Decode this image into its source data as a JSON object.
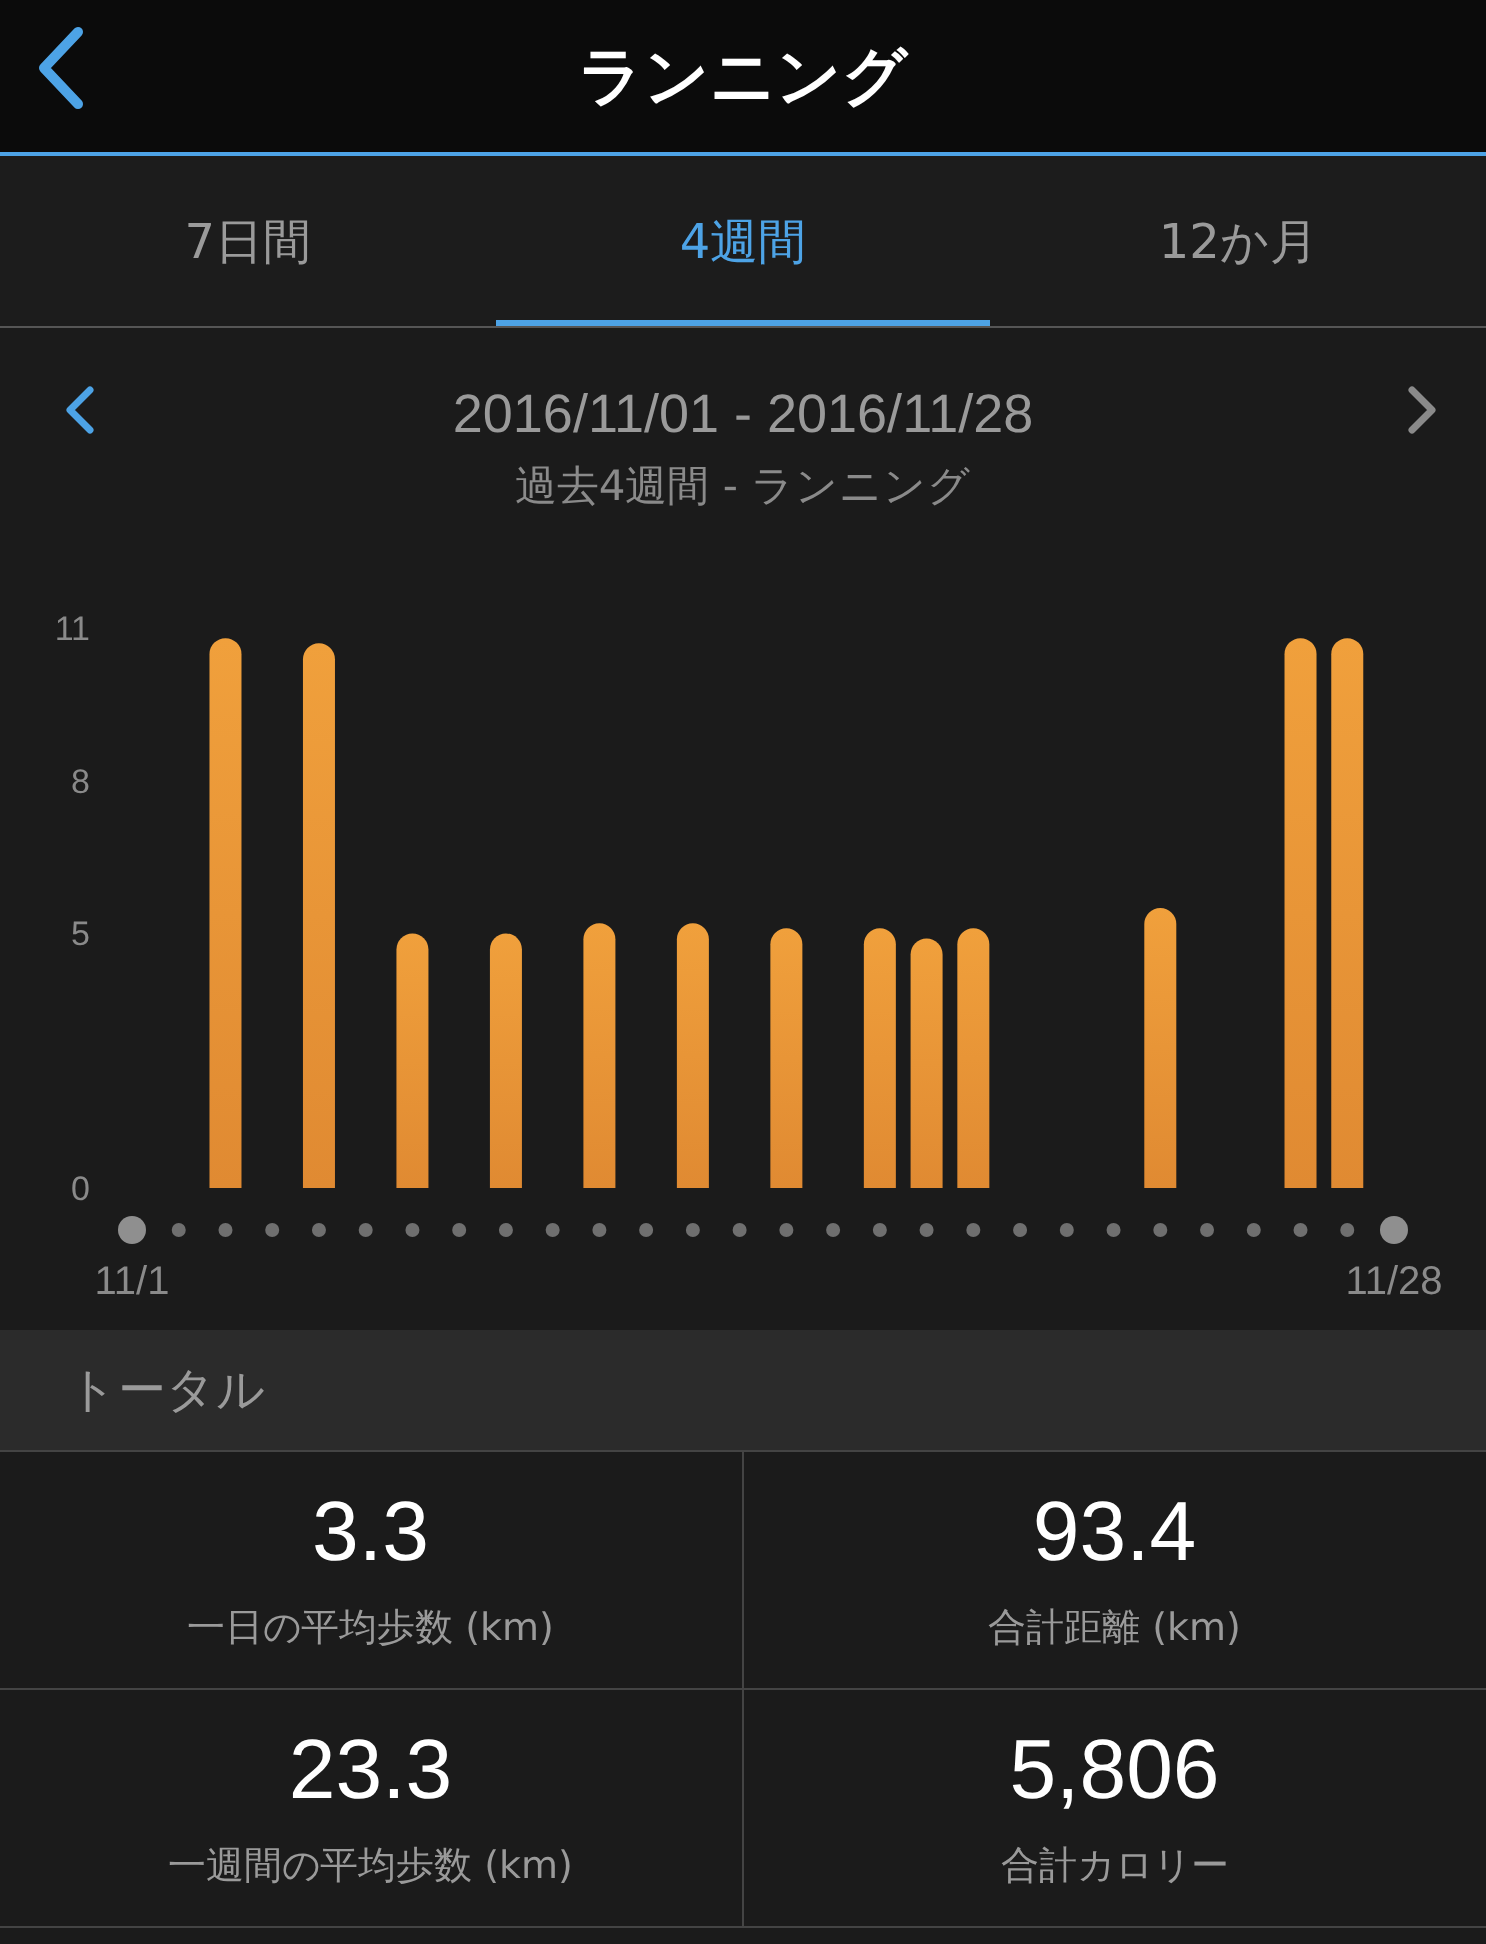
{
  "header": {
    "title": "ランニング"
  },
  "tabs": [
    {
      "label": "7日間",
      "selected": false
    },
    {
      "label": "4週間",
      "selected": true
    },
    {
      "label": "12か月",
      "selected": false
    }
  ],
  "period": {
    "range": "2016/11/01 - 2016/11/28",
    "subtitle": "過去4週間 - ランニング"
  },
  "chart_data": {
    "type": "bar",
    "categories": [
      "11/1",
      null,
      null,
      null,
      null,
      null,
      null,
      null,
      null,
      null,
      null,
      null,
      null,
      null,
      null,
      null,
      null,
      null,
      null,
      null,
      null,
      null,
      null,
      null,
      null,
      null,
      null,
      "11/28"
    ],
    "series": [
      {
        "color": "#f0a03c",
        "values": [
          null,
          null,
          10.8,
          null,
          10.7,
          null,
          5.0,
          null,
          5.0,
          null,
          5.2,
          null,
          5.2,
          null,
          5.1,
          null,
          5.1,
          4.9,
          5.1,
          null,
          null,
          null,
          5.5,
          null,
          null,
          10.8,
          10.8,
          null
        ]
      }
    ],
    "ylim": [
      0,
      11
    ],
    "yticks": [
      0,
      5,
      8,
      11
    ]
  },
  "totals": {
    "title": "トータル",
    "stats": [
      {
        "value": "3.3",
        "label": "一日の平均歩数 (km)"
      },
      {
        "value": "93.4",
        "label": "合計距離 (km)"
      },
      {
        "value": "23.3",
        "label": "一週間の平均歩数 (km)"
      },
      {
        "value": "5,806",
        "label": "合計カロリー"
      }
    ]
  }
}
